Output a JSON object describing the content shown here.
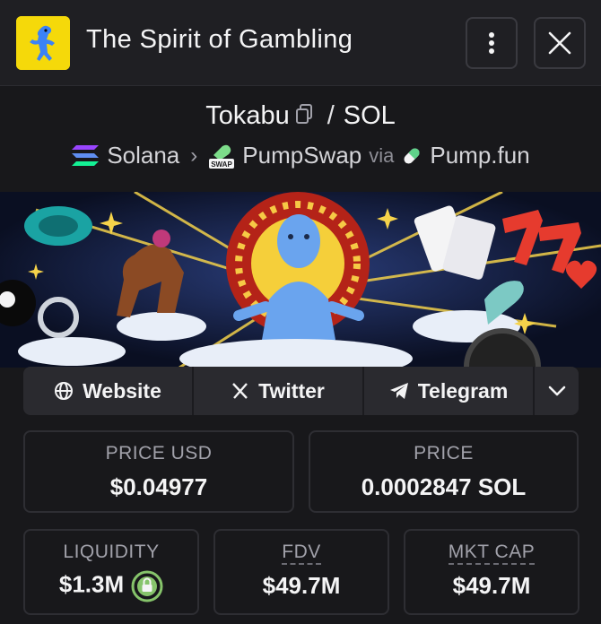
{
  "header": {
    "title": "The Spirit of Gambling",
    "more_icon": "vertical-dots-icon",
    "close_icon": "close-icon"
  },
  "pair": {
    "base": "Tokabu",
    "separator": "/",
    "quote": "SOL"
  },
  "chain": {
    "network": "Solana",
    "dex": "PumpSwap",
    "via_label": "via",
    "launchpad": "Pump.fun",
    "dex_badge": "SWAP"
  },
  "links": {
    "website": "Website",
    "twitter": "Twitter",
    "telegram": "Telegram"
  },
  "stats": {
    "price_usd_label": "PRICE USD",
    "price_usd": "$0.04977",
    "price_label": "PRICE",
    "price": "0.0002847 SOL",
    "liquidity_label": "LIQUIDITY",
    "liquidity": "$1.3M",
    "fdv_label": "FDV",
    "fdv": "$49.7M",
    "mktcap_label": "MKT CAP",
    "mktcap": "$49.7M"
  },
  "colors": {
    "background": "#18181b",
    "logo_bg": "#f5d90a",
    "lock_green": "#86c46b"
  }
}
